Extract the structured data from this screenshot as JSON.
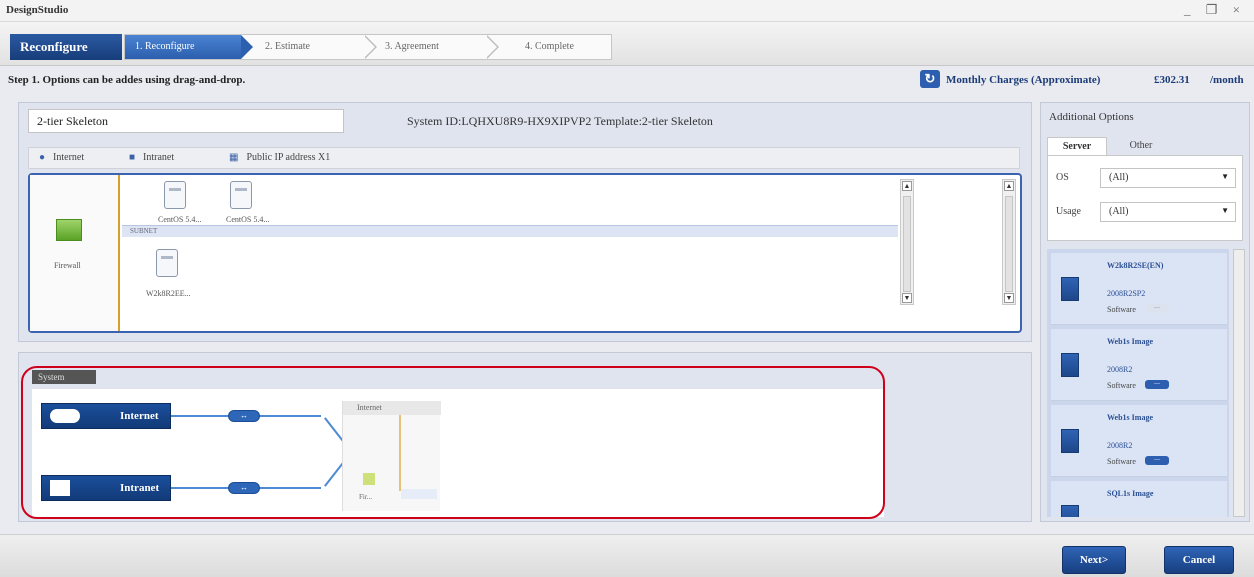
{
  "app": {
    "title": "DesignStudio"
  },
  "window": {
    "controls": "_ ❐ ×"
  },
  "wizard": {
    "brand": "Reconfigure",
    "steps": [
      {
        "label": "1. Reconfigure",
        "active": true
      },
      {
        "label": "2. Estimate",
        "active": false
      },
      {
        "label": "3. Agreement",
        "active": false
      },
      {
        "label": "4. Complete",
        "active": false
      }
    ]
  },
  "instruction": "Step 1. Options can be addes using drag-and-drop.",
  "charges": {
    "refresh_icon": "refresh-icon",
    "label": "Monthly Charges (Approximate)",
    "amount": "£302.31",
    "unit": "/month"
  },
  "system": {
    "name": "2-tier Skeleton",
    "id_text": "System ID:LQHXU8R9-HX9XIPVP2  Template:2-tier Skeleton"
  },
  "network_bar": [
    {
      "icon": "globe-icon",
      "label": "Internet"
    },
    {
      "icon": "intranet-icon",
      "label": "Intranet"
    },
    {
      "icon": "ip-icon",
      "label": "Public IP address X1"
    }
  ],
  "canvas": {
    "firewall_label": "Firewall",
    "servers_top": [
      "CentOS 5.4...",
      "CentOS 5.4..."
    ],
    "subnet_label": "SUBNET",
    "server_bottom": "W2k8R2EE..."
  },
  "system_map": {
    "tag": "System",
    "nodes": [
      "Internet",
      "Intranet"
    ],
    "minimap_header": "Internet",
    "minimap_fw": "Fir..."
  },
  "additional": {
    "title": "Additional Options",
    "tabs": [
      "Server",
      "Other"
    ],
    "filters": [
      {
        "label": "OS",
        "value": "(All)"
      },
      {
        "label": "Usage",
        "value": "(All)"
      }
    ],
    "cards": [
      {
        "name": "W2k8R2SE(EN)",
        "version": "2008R2SP2",
        "meta": "Software",
        "badge": "—"
      },
      {
        "name": "Web1s Image",
        "version": "2008R2",
        "meta": "Software",
        "badge": "—"
      },
      {
        "name": "Web1s Image",
        "version": "2008R2",
        "meta": "Software",
        "badge": "—"
      },
      {
        "name": "SQL1s Image",
        "version": "",
        "meta": "",
        "badge": ""
      }
    ]
  },
  "footer": {
    "next": "Next>",
    "cancel": "Cancel"
  },
  "colors": {
    "primary": "#1b4f9c",
    "highlight": "#d0021b",
    "accent": "#d6a02d"
  }
}
